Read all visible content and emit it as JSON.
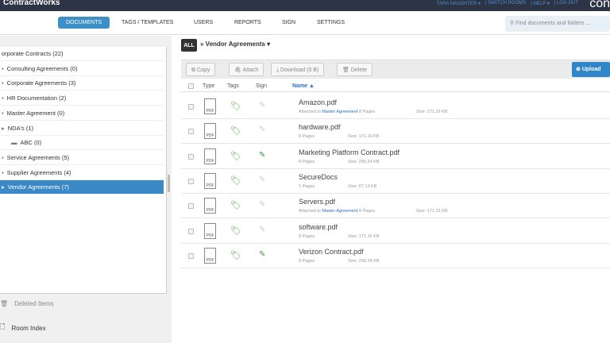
{
  "app": {
    "brand": "ContractWorks",
    "logo_partial": "con"
  },
  "user_nav": [
    "TARA NAUGHTER ▾",
    "| SWITCH ROOMS",
    "| HELP ▾",
    "| LOG OUT"
  ],
  "tabs": [
    "DOCUMENTS",
    "TAGS / TEMPLATES",
    "USERS",
    "REPORTS",
    "SIGN",
    "SETTINGS"
  ],
  "search": {
    "placeholder": "Find documents and folders ..."
  },
  "sidebar": {
    "items": [
      {
        "label": "orporate Contracts (22)",
        "icon": ""
      },
      {
        "label": "Consulting Agreements (0)",
        "icon": "▪"
      },
      {
        "label": "Corporate Agreements (3)",
        "icon": "▪"
      },
      {
        "label": "HR Documentation (2)",
        "icon": "▪"
      },
      {
        "label": "Master Agreement (0)",
        "icon": "▪"
      },
      {
        "label": "NDA's (1)",
        "icon": "▸"
      },
      {
        "label": "ABC (0)",
        "icon": "▬"
      },
      {
        "label": "Service Agreements (5)",
        "icon": "▪"
      },
      {
        "label": "Supplier Agreements (4)",
        "icon": "▪"
      },
      {
        "label": "Vendor Agreements (7)",
        "icon": "▸",
        "selected": true
      }
    ],
    "deleted": "Deleted Items",
    "room_index": "Room Index"
  },
  "main": {
    "all": "ALL",
    "breadcrumb": "» Vendor Agreements ▾",
    "toolbar": {
      "copy": "Copy",
      "attach": "Attach",
      "download": "Download (0 B)",
      "delete": "Delete",
      "upload": "Upload"
    },
    "columns": {
      "type": "Type",
      "tags": "Tags",
      "sign": "Sign",
      "name": "Name ▲"
    },
    "files": [
      {
        "name": "Amazon.pdf",
        "attached": "Master Agreement",
        "attached_prefix": "Attached to",
        "pages": "8 Pages",
        "size": "Size: 171.16 KB",
        "signed": false
      },
      {
        "name": "hardware.pdf",
        "pages": "8 Pages",
        "size": "Size: 171.16 KB",
        "signed": false
      },
      {
        "name": "Marketing Platform Contract.pdf",
        "pages": "8 Pages",
        "size": "Size: 206.34 KB",
        "signed": true
      },
      {
        "name": "SecureDocs",
        "pages": "1 Pages",
        "size": "Size: 87.13 KB",
        "signed": false
      },
      {
        "name": "Servers.pdf",
        "attached": "Master Agreement",
        "attached_prefix": "Attached to",
        "pages": "8 Pages",
        "size": "Size: 171.16 KB",
        "signed": false
      },
      {
        "name": "software.pdf",
        "pages": "8 Pages",
        "size": "Size: 171.16 KB",
        "signed": false
      },
      {
        "name": "Verizon Contract.pdf",
        "pages": "8 Pages",
        "size": "Size: 206.34 KB",
        "signed": true
      }
    ],
    "pdf_label": "PDF"
  },
  "colors": {
    "topbar": "#2c3445",
    "accent": "#3a88c5",
    "tag": "#5aaa4c"
  }
}
